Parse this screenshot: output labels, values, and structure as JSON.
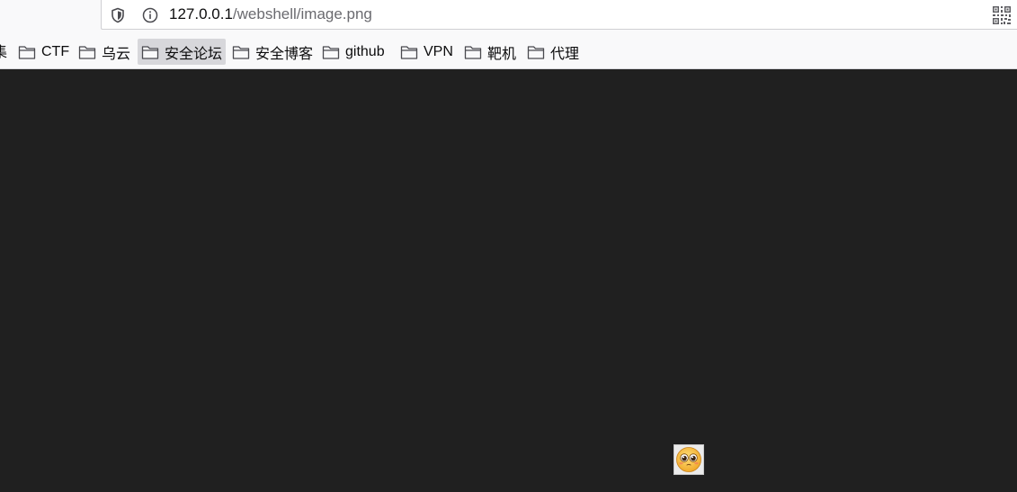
{
  "urlbar": {
    "url_host": "127.0.0.1",
    "url_path": "/webshell/image.png"
  },
  "icons": {
    "tracking": "shield-icon",
    "info": "info-icon",
    "qr": "qr-code-icon",
    "folder": "folder-icon",
    "broken_image": "emoji-face-icon"
  },
  "bookmarks": {
    "partial_label": "集",
    "items": [
      {
        "label": "CTF",
        "active": false
      },
      {
        "label": "乌云",
        "active": false
      },
      {
        "label": "安全论坛",
        "active": true
      },
      {
        "label": "安全博客",
        "active": false
      },
      {
        "label": "github",
        "active": false
      },
      {
        "label": "VPN",
        "active": false
      },
      {
        "label": "靶机",
        "active": false
      },
      {
        "label": "代理",
        "active": false
      }
    ]
  },
  "colors": {
    "page_background": "#202020",
    "toolbar_background": "#f9f9fa",
    "active_bookmark": "#d7d7db"
  }
}
